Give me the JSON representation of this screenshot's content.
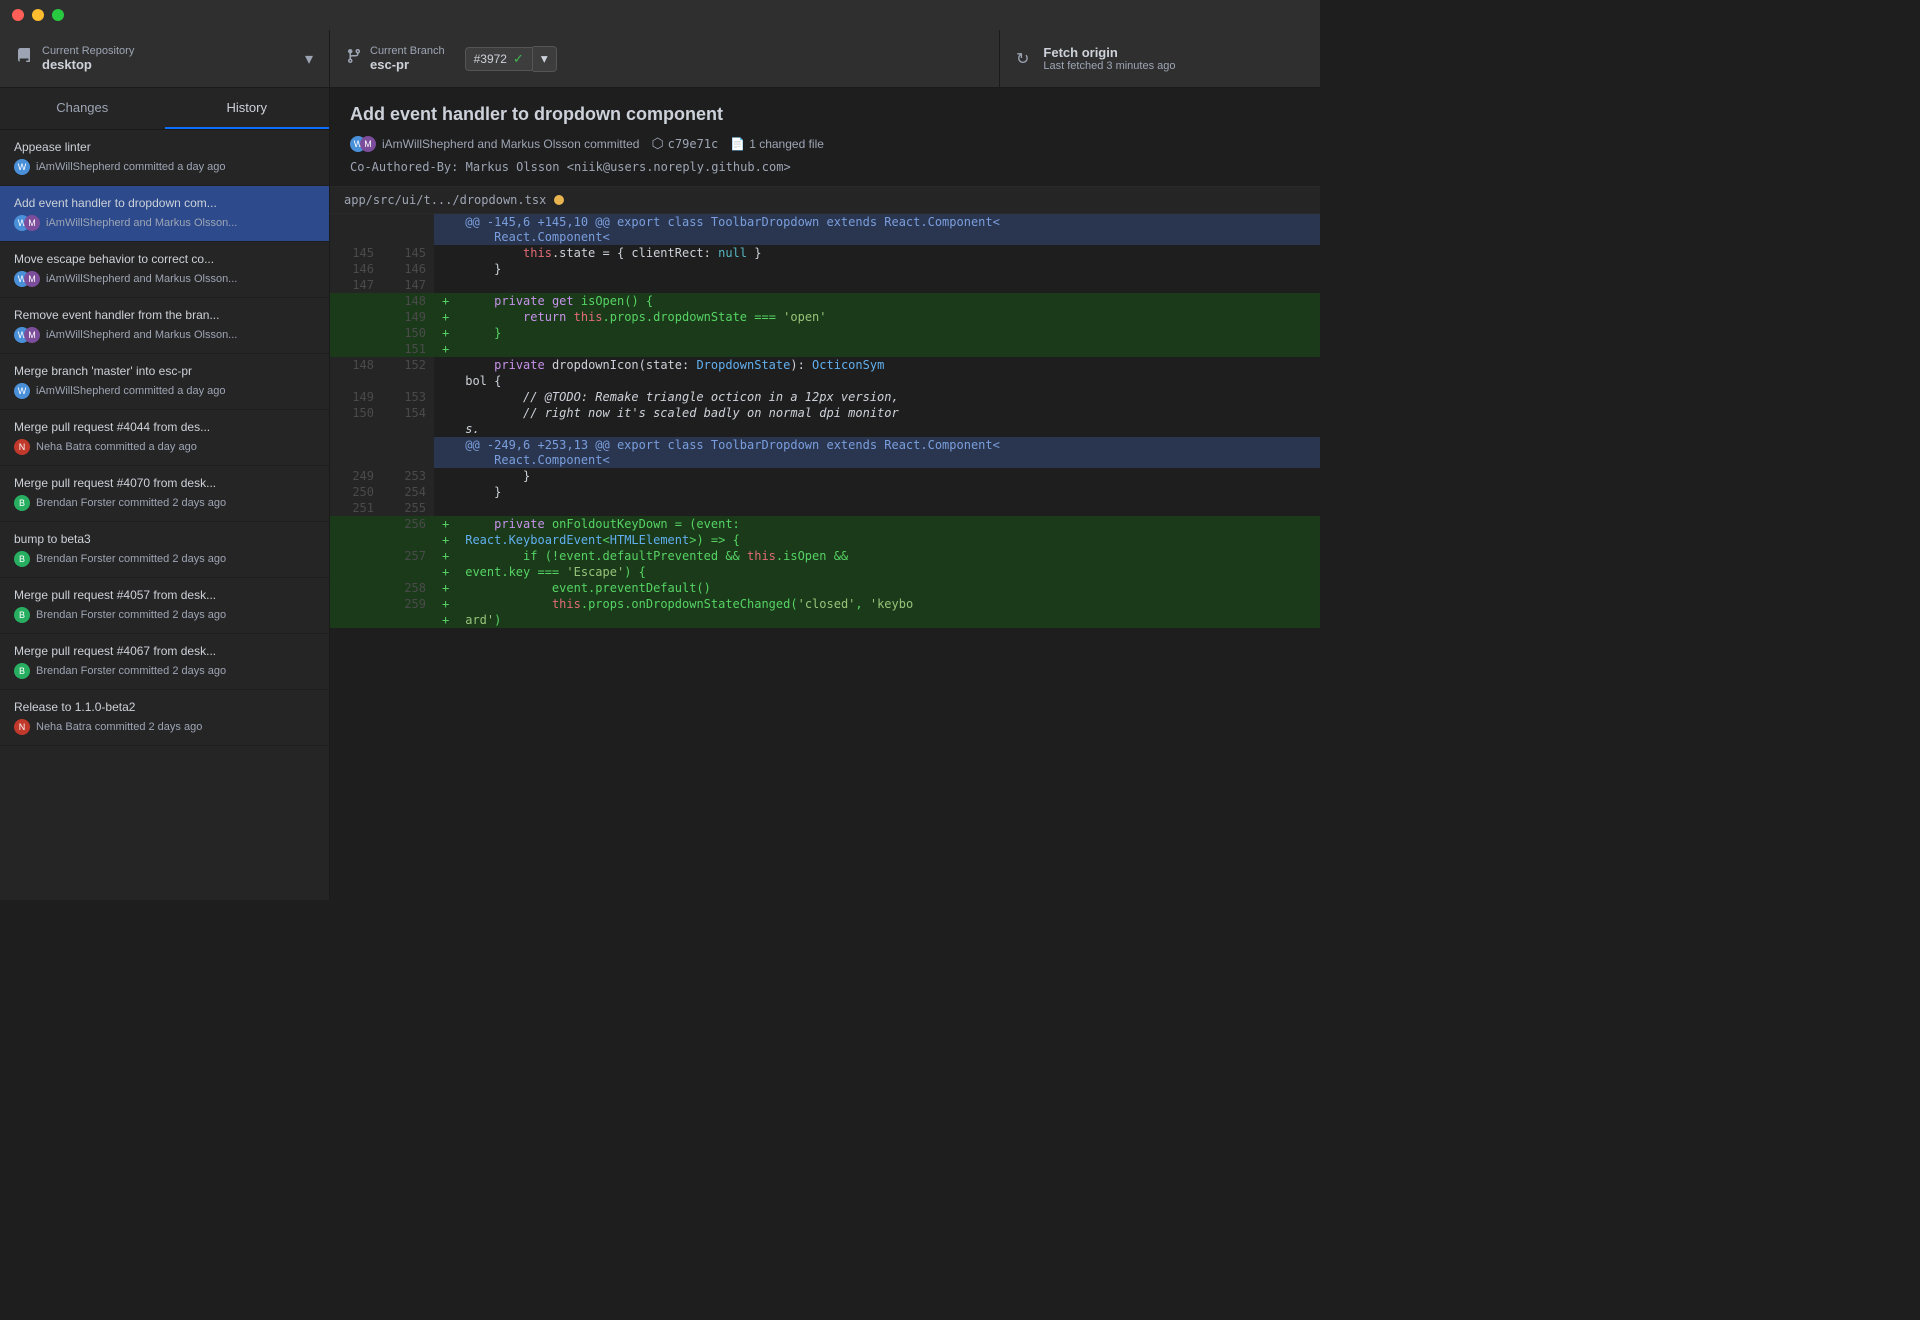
{
  "titleBar": {
    "trafficLights": [
      "red",
      "yellow",
      "green"
    ]
  },
  "toolbar": {
    "repo": {
      "label": "Current Repository",
      "value": "desktop"
    },
    "branch": {
      "label": "Current Branch",
      "value": "esc-pr",
      "badgeNumber": "#3972"
    },
    "fetch": {
      "label": "Fetch origin",
      "sublabel": "Last fetched 3 minutes ago"
    }
  },
  "sidebar": {
    "tabs": [
      "Changes",
      "History"
    ],
    "activeTab": "History",
    "commits": [
      {
        "title": "Appease linter",
        "author": "iAmWillShepherd committed a day ago",
        "avatarType": "single-will",
        "selected": false
      },
      {
        "title": "Add event handler to dropdown com...",
        "author": "iAmWillShepherd and Markus Olsson...",
        "avatarType": "pair-will-markus",
        "selected": true
      },
      {
        "title": "Move escape behavior to correct co...",
        "author": "iAmWillShepherd and Markus Olsson...",
        "avatarType": "pair-will-markus",
        "selected": false
      },
      {
        "title": "Remove event handler from the bran...",
        "author": "iAmWillShepherd and Markus Olsson...",
        "avatarType": "pair-will-markus",
        "selected": false
      },
      {
        "title": "Merge branch 'master' into esc-pr",
        "author": "iAmWillShepherd committed a day ago",
        "avatarType": "single-will",
        "selected": false
      },
      {
        "title": "Merge pull request #4044 from des...",
        "author": "Neha Batra committed a day ago",
        "avatarType": "single-neha",
        "selected": false
      },
      {
        "title": "Merge pull request #4070 from desk...",
        "author": "Brendan Forster committed 2 days ago",
        "avatarType": "single-brendan",
        "selected": false
      },
      {
        "title": "bump to beta3",
        "author": "Brendan Forster committed 2 days ago",
        "avatarType": "single-brendan",
        "selected": false
      },
      {
        "title": "Merge pull request #4057 from desk...",
        "author": "Brendan Forster committed 2 days ago",
        "avatarType": "single-brendan",
        "selected": false
      },
      {
        "title": "Merge pull request #4067 from desk...",
        "author": "Brendan Forster committed 2 days ago",
        "avatarType": "single-brendan",
        "selected": false
      },
      {
        "title": "Release to 1.1.0-beta2",
        "author": "Neha Batra committed 2 days ago",
        "avatarType": "single-neha",
        "selected": false
      }
    ]
  },
  "commitDetail": {
    "title": "Add event handler to dropdown component",
    "authors": "iAmWillShepherd and Markus Olsson committed",
    "hash": "c79e71c",
    "changedFiles": "1 changed file",
    "message": "Co-Authored-By: Markus Olsson <niik@users.noreply.github.com>"
  },
  "diff": {
    "filePath": "app/src/ui/t.../dropdown.tsx",
    "hunks": [
      {
        "type": "hunk-header",
        "content": "@@ -145,6 +145,10 @@ export class ToolbarDropdown extends React.Component<"
      },
      {
        "type": "context",
        "oldLine": "145",
        "newLine": "145",
        "content": "        this.state = { clientRect: null }"
      },
      {
        "type": "context",
        "oldLine": "146",
        "newLine": "146",
        "content": "    }"
      },
      {
        "type": "context",
        "oldLine": "147",
        "newLine": "147",
        "content": ""
      },
      {
        "type": "added",
        "oldLine": "",
        "newLine": "148",
        "content": "    private get isOpen() {"
      },
      {
        "type": "added",
        "oldLine": "",
        "newLine": "149",
        "content": "        return this.props.dropdownState === 'open'"
      },
      {
        "type": "added",
        "oldLine": "",
        "newLine": "150",
        "content": "    }"
      },
      {
        "type": "added",
        "oldLine": "",
        "newLine": "151",
        "content": ""
      },
      {
        "type": "context",
        "oldLine": "148",
        "newLine": "152",
        "content": "    private dropdownIcon(state: DropdownState): OcticonSym"
      },
      {
        "type": "context-wrap",
        "oldLine": "",
        "newLine": "",
        "content": "bol {"
      },
      {
        "type": "context",
        "oldLine": "149",
        "newLine": "153",
        "content": "        // @TODO: Remake triangle octicon in a 12px version,"
      },
      {
        "type": "context",
        "oldLine": "150",
        "newLine": "154",
        "content": "        // right now it's scaled badly on normal dpi monitor"
      },
      {
        "type": "context-wrap2",
        "content": "s."
      }
    ]
  },
  "diff2": {
    "hunks": [
      {
        "type": "hunk-header",
        "content": "@@ -249,6 +253,13 @@ export class ToolbarDropdown extends React.Component<"
      },
      {
        "type": "context2",
        "content": "React.Component<"
      },
      {
        "type": "context",
        "oldLine": "249",
        "newLine": "253",
        "content": "        }"
      },
      {
        "type": "context",
        "oldLine": "250",
        "newLine": "254",
        "content": "    }"
      },
      {
        "type": "context",
        "oldLine": "251",
        "newLine": "255",
        "content": ""
      },
      {
        "type": "added",
        "oldLine": "",
        "newLine": "256",
        "content": "    private onFoldoutKeyDown = (event:"
      },
      {
        "type": "added-wrap",
        "content": "React.KeyboardEvent<HTMLElement>) => {"
      },
      {
        "type": "added",
        "oldLine": "",
        "newLine": "257",
        "content": "        if (!event.defaultPrevented && this.isOpen &&"
      },
      {
        "type": "added-wrap2",
        "content": "event.key === 'Escape') {"
      },
      {
        "type": "added",
        "oldLine": "",
        "newLine": "258",
        "content": "            event.preventDefault()"
      },
      {
        "type": "added",
        "oldLine": "",
        "newLine": "259",
        "content": "            this.props.onDropdownStateChanged('closed', 'keybo"
      },
      {
        "type": "added-wrap3",
        "content": "ard')"
      }
    ]
  }
}
